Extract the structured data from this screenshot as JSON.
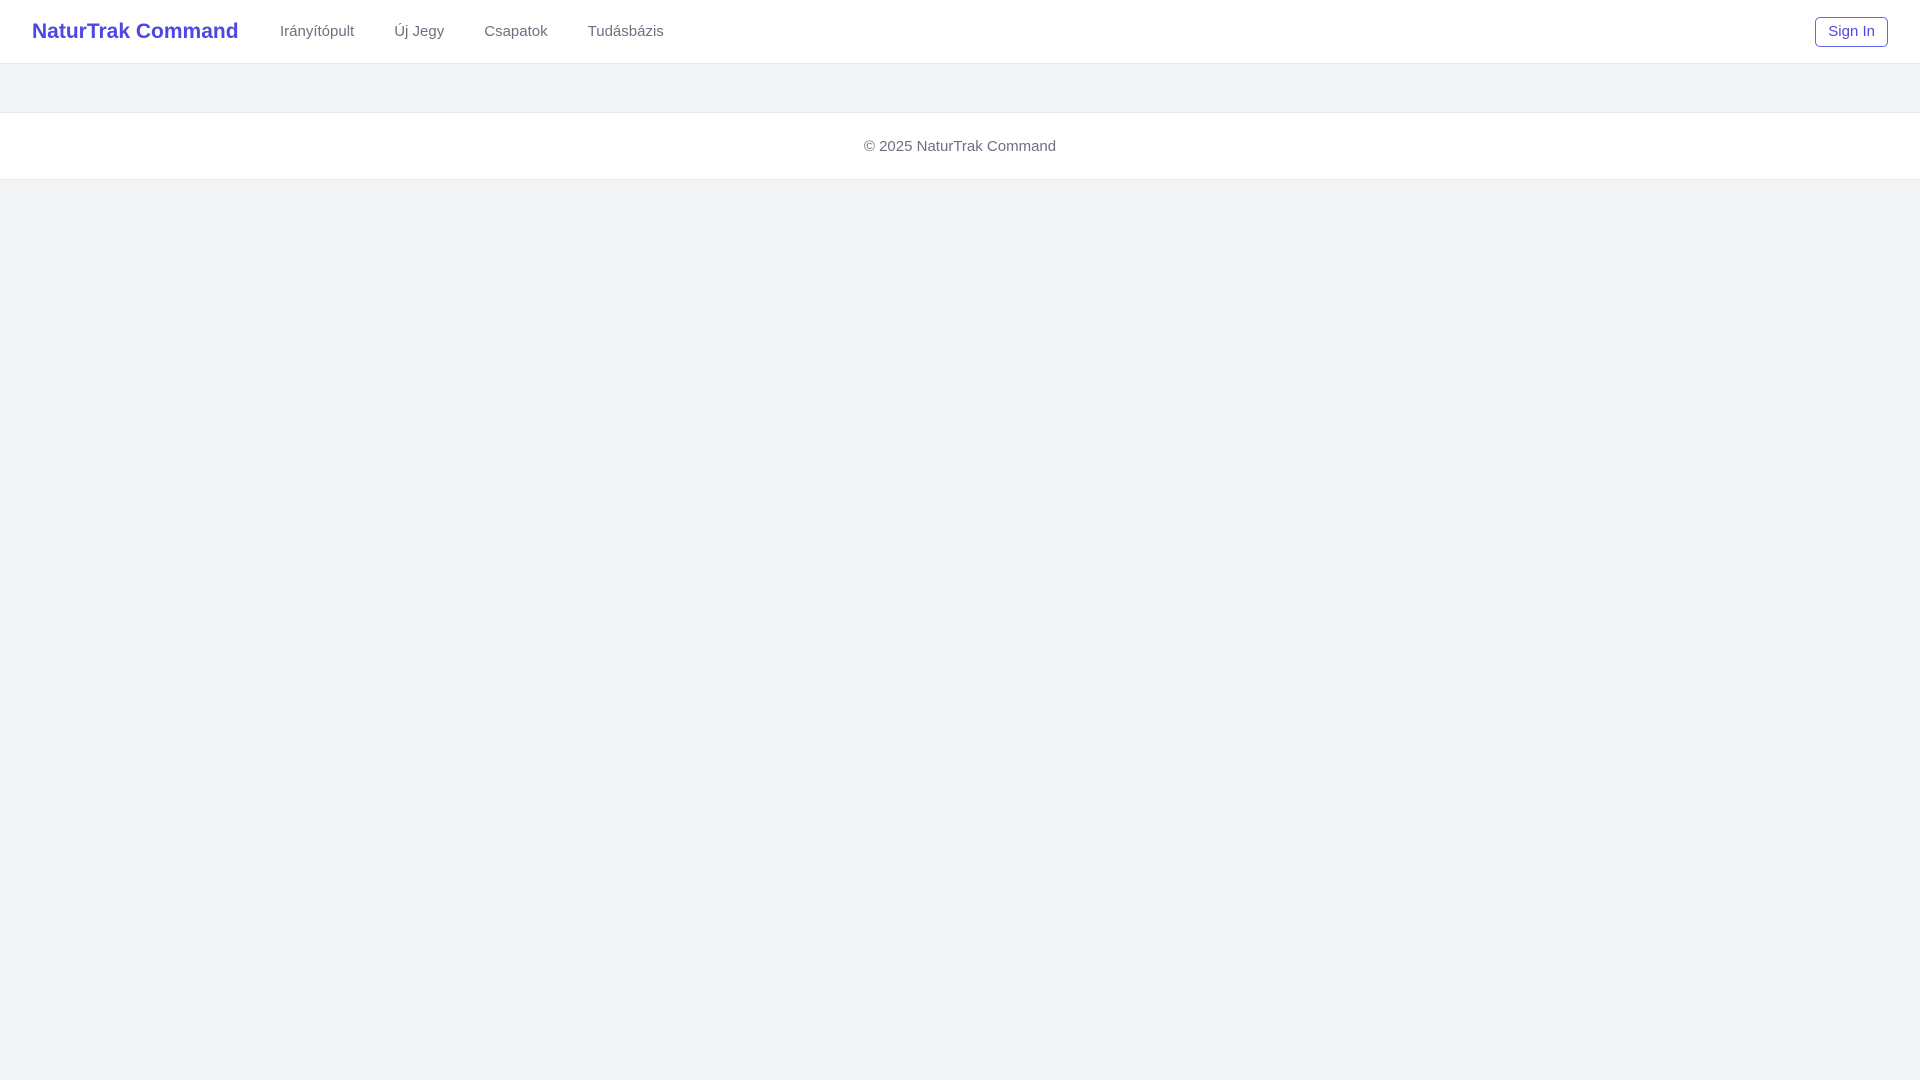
{
  "header": {
    "brand": "NaturTrak Command",
    "nav": [
      {
        "label": "Irányítópult"
      },
      {
        "label": "Új Jegy"
      },
      {
        "label": "Csapatok"
      },
      {
        "label": "Tudásbázis"
      }
    ],
    "signin_label": "Sign In"
  },
  "footer": {
    "copyright": "© 2025 NaturTrak Command"
  },
  "colors": {
    "accent": "#4f46e5",
    "page_background": "#f3f4f6",
    "muted_text": "#6b7280"
  }
}
